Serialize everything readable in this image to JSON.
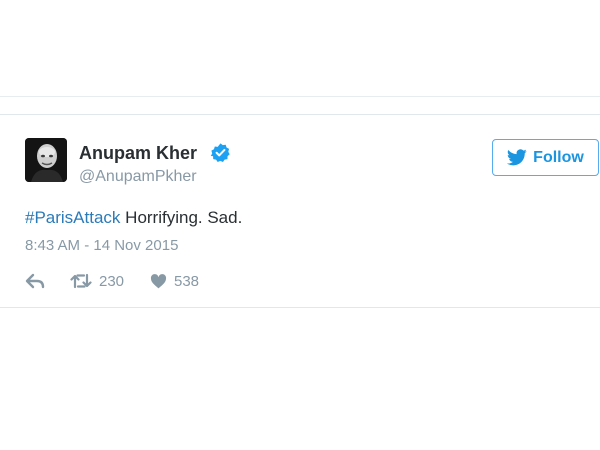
{
  "tweet": {
    "author": {
      "name": "Anupam Kher",
      "handle": "@AnupamPkher",
      "verified": true
    },
    "follow_label": "Follow",
    "text": {
      "hashtag": "#ParisAttack",
      "body": " Horrifying. Sad."
    },
    "timestamp": "8:43 AM - 14 Nov 2015",
    "actions": {
      "reply_icon": "reply-icon",
      "retweets": "230",
      "likes": "538"
    }
  },
  "colors": {
    "accent": "#1b95e0",
    "hashtag": "#2b7bb9",
    "text": "#292f33",
    "muted": "#8899a6",
    "verified": "#1da1f2"
  }
}
